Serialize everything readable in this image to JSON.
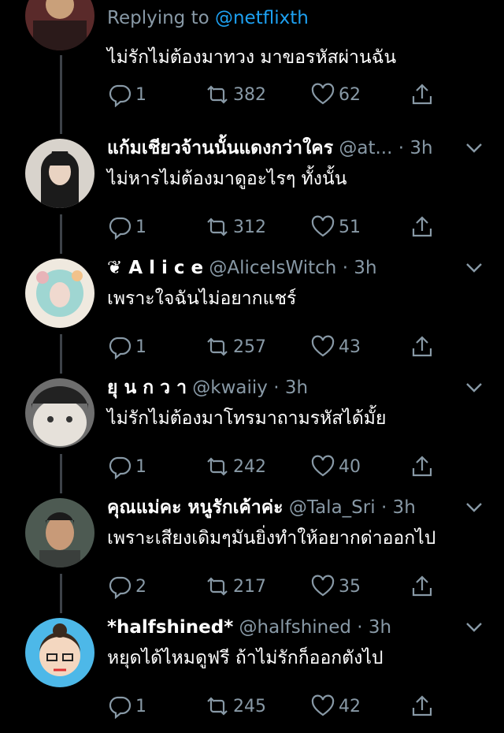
{
  "first": {
    "replying_prefix": "Replying to",
    "replying_handle": "@netflixth",
    "text": "ไม่รักไม่ต้องมาทวง มาขอรหัสผ่านฉัน",
    "replies": "1",
    "retweets": "382",
    "likes": "62"
  },
  "tweets": [
    {
      "name": "แก้มเชียวจ้านนั้นแดงกว่าใคร",
      "handle": "@at...",
      "time": "· 3h",
      "text": "ไม่หารไม่ต้องมาดูอะไรๆ ทั้งนั้น",
      "replies": "1",
      "retweets": "312",
      "likes": "51"
    },
    {
      "name": "❦ A l i c e",
      "handle": "@AliceIsWitch",
      "time": "· 3h",
      "text": "เพราะใจฉันไม่อยากแชร์",
      "replies": "1",
      "retweets": "257",
      "likes": "43"
    },
    {
      "name": "ยุ น ก ว า",
      "handle": "@kwaiiy",
      "time": "· 3h",
      "text": "ไม่รักไม่ต้องมาโทรมาถามรหัสได้มั้ย",
      "replies": "1",
      "retweets": "242",
      "likes": "40"
    },
    {
      "name": "คุณแม่คะ หนูรักเค้าค่ะ",
      "handle": "@Tala_Sri",
      "time": "· 3h",
      "text": "เพราะเสียงเดิมๆมันยิ่งทำให้อยากด่าออกไป",
      "replies": "2",
      "retweets": "217",
      "likes": "35"
    },
    {
      "name": "*halfshined*",
      "handle": "@halfshined",
      "time": "· 3h",
      "text": "หยุดได้ไหมดูฟรี ถ้าไม่รักก็ออกตังไป",
      "replies": "1",
      "retweets": "245",
      "likes": "42"
    }
  ],
  "colors": {
    "background": "#000000",
    "muted": "#8899a6",
    "link": "#1da1f2",
    "thread": "#3d4248"
  }
}
